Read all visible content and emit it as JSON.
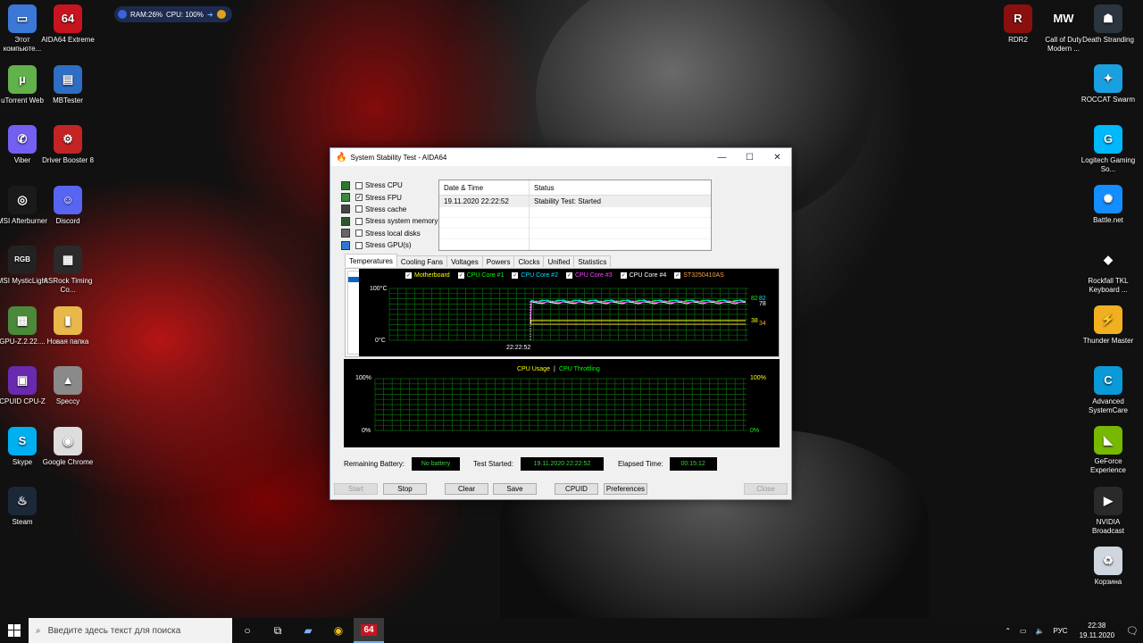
{
  "widget": {
    "ram": "RAM:26%",
    "cpu": "CPU: 100%"
  },
  "desktop_left": [
    {
      "label": "Этот компьюте...",
      "color": "#3b78d8",
      "glyph": "▭"
    },
    {
      "label": "AIDA64 Extreme",
      "color": "#c8141e",
      "glyph": "64"
    },
    {
      "label": "uTorrent Web",
      "color": "#62b14a",
      "glyph": "µ"
    },
    {
      "label": "MBTester",
      "color": "#2e6ec4",
      "glyph": "▤"
    },
    {
      "label": "Viber",
      "color": "#7360f2",
      "glyph": "✆"
    },
    {
      "label": "Driver Booster 8",
      "color": "#c42424",
      "glyph": "⚙"
    },
    {
      "label": "MSI Afterburner",
      "color": "#1a1a1a",
      "glyph": "◎"
    },
    {
      "label": "Discord",
      "color": "#5865f2",
      "glyph": "☺"
    },
    {
      "label": "MSI MysticLight",
      "color": "#222222",
      "glyph": "RGB"
    },
    {
      "label": "ASRock Timing Co...",
      "color": "#2a2a2a",
      "glyph": "▦"
    },
    {
      "label": "GPU-Z.2.22....",
      "color": "#4a8a3a",
      "glyph": "▩"
    },
    {
      "label": "Новая папка",
      "color": "#e8b84a",
      "glyph": "▮"
    },
    {
      "label": "CPUID CPU-Z",
      "color": "#6a2ab0",
      "glyph": "▣"
    },
    {
      "label": "Speccy",
      "color": "#8a8a8a",
      "glyph": "▲"
    },
    {
      "label": "Skype",
      "color": "#00aff0",
      "glyph": "S"
    },
    {
      "label": "Google Chrome",
      "color": "#dddddd",
      "glyph": "◉"
    },
    {
      "label": "Steam",
      "color": "#1b2838",
      "glyph": "♨"
    }
  ],
  "desktop_right": [
    {
      "label": "RDR2",
      "color": "#8a1010",
      "glyph": "R"
    },
    {
      "label": "Call of Duty Modern ...",
      "color": "#111111",
      "glyph": "MW"
    },
    {
      "label": "Death Stranding",
      "color": "#2a3540",
      "glyph": "☗"
    },
    {
      "label": "ROCCAT Swarm",
      "color": "#1aa0e0",
      "glyph": "✦"
    },
    {
      "label": "Logitech Gaming So...",
      "color": "#00b8fc",
      "glyph": "G"
    },
    {
      "label": "Battle.net",
      "color": "#148eff",
      "glyph": "✺"
    },
    {
      "label": "Rockfall TKL Keyboard ...",
      "color": "#111111",
      "glyph": "◆"
    },
    {
      "label": "Thunder Master",
      "color": "#f0b020",
      "glyph": "⚡"
    },
    {
      "label": "Advanced SystemCare",
      "color": "#0a9ad8",
      "glyph": "C"
    },
    {
      "label": "GeForce Experience",
      "color": "#76b900",
      "glyph": "◣"
    },
    {
      "label": "NVIDIA Broadcast",
      "color": "#2a2a2a",
      "glyph": "▶"
    },
    {
      "label": "Корзина",
      "color": "#cfd6df",
      "glyph": "♻"
    }
  ],
  "window": {
    "title": "System Stability Test - AIDA64",
    "stress": [
      {
        "label": "Stress CPU",
        "checked": false,
        "icon_color": "#2a7a2a"
      },
      {
        "label": "Stress FPU",
        "checked": true,
        "icon_color": "#3a8a3a"
      },
      {
        "label": "Stress cache",
        "checked": false,
        "icon_color": "#444444"
      },
      {
        "label": "Stress system memory",
        "checked": false,
        "icon_color": "#2a5a2a"
      },
      {
        "label": "Stress local disks",
        "checked": false,
        "icon_color": "#666666"
      },
      {
        "label": "Stress GPU(s)",
        "checked": false,
        "icon_color": "#2a7ad0"
      }
    ],
    "log": {
      "col_date": "Date & Time",
      "col_status": "Status",
      "rows": [
        {
          "date": "19.11.2020 22:22:52",
          "status": "Stability Test: Started"
        }
      ]
    },
    "tabs": [
      "Temperatures",
      "Cooling Fans",
      "Voltages",
      "Powers",
      "Clocks",
      "Unified",
      "Statistics"
    ],
    "active_tab": "Temperatures",
    "temp_chart": {
      "legend": [
        {
          "name": "Motherboard",
          "color": "#ffff00"
        },
        {
          "name": "CPU Core #1",
          "color": "#00ff00"
        },
        {
          "name": "CPU Core #2",
          "color": "#00e0ff"
        },
        {
          "name": "CPU Core #3",
          "color": "#ff40ff"
        },
        {
          "name": "CPU Core #4",
          "color": "#ffffff"
        },
        {
          "name": "ST3250410AS",
          "color": "#ffa040"
        }
      ],
      "y_top": "100°C",
      "y_bottom": "0°C",
      "x_label": "22:22:52",
      "right_labels": [
        "82",
        "82",
        "78",
        "38",
        "34"
      ]
    },
    "usage_chart": {
      "title_usage": "CPU Usage",
      "separator": "|",
      "title_throttle": "CPU Throttling",
      "y_top": "100%",
      "y_bottom": "0%",
      "right_top": "100%",
      "right_bottom": "0%"
    },
    "info": {
      "battery_label": "Remaining Battery:",
      "battery_value": "No battery",
      "started_label": "Test Started:",
      "started_value": "19.11.2020 22:22:52",
      "elapsed_label": "Elapsed Time:",
      "elapsed_value": "00:15:12"
    },
    "buttons": {
      "start": "Start",
      "stop": "Stop",
      "clear": "Clear",
      "save": "Save",
      "cpuid": "CPUID",
      "preferences": "Preferences",
      "close": "Close"
    }
  },
  "taskbar": {
    "search_placeholder": "Введите здесь текст для поиска",
    "lang": "РУС",
    "time": "22:38",
    "date": "19.11.2020"
  }
}
